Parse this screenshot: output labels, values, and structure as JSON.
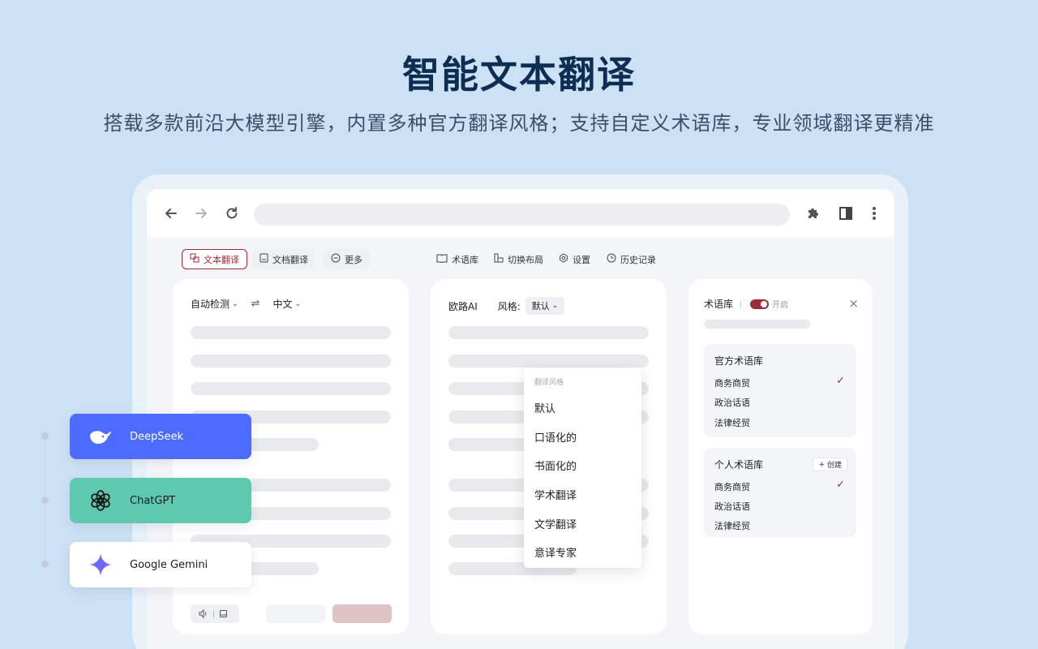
{
  "hero": {
    "title": "智能文本翻译",
    "subtitle": "搭载多款前沿大模型引擎，内置多种官方翻译风格；支持自定义术语库，专业领域翻译更精准"
  },
  "browser": {
    "icons": [
      "back-arrow-icon",
      "forward-arrow-icon",
      "reload-icon",
      "puzzle-icon",
      "side-panel-icon",
      "kebab-menu-icon"
    ]
  },
  "topbar": {
    "tabs": [
      {
        "label": "文本翻译",
        "icon": "text-translate-icon",
        "active": true
      },
      {
        "label": "文档翻译",
        "icon": "document-icon",
        "active": false
      },
      {
        "label": "更多",
        "icon": "more-circle-icon",
        "active": false
      }
    ],
    "tools": [
      {
        "label": "术语库",
        "icon": "book-icon"
      },
      {
        "label": "切换布局",
        "icon": "layout-icon"
      },
      {
        "label": "设置",
        "icon": "settings-icon"
      },
      {
        "label": "历史记录",
        "icon": "clock-icon"
      }
    ]
  },
  "source_panel": {
    "source_lang": "自动检测",
    "swap_icon": "swap-icon",
    "target_lang": "中文",
    "footer_icons": [
      "speaker-icon",
      "copy-icon"
    ]
  },
  "result_panel": {
    "engine": "欧路AI",
    "style_label": "风格:",
    "style_value": "默认"
  },
  "style_dropdown": {
    "header": "翻译风格",
    "options": [
      "默认",
      "口语化的",
      "书面化的",
      "学术翻译",
      "文学翻译",
      "意译专家"
    ]
  },
  "term_panel": {
    "title": "术语库",
    "toggle_label": "开启",
    "toggle_on": true,
    "official": {
      "title": "官方术语库",
      "items": [
        {
          "label": "商务商贸",
          "checked": true
        },
        {
          "label": "政治话语",
          "checked": false
        },
        {
          "label": "法律经贸",
          "checked": false
        }
      ]
    },
    "personal": {
      "title": "个人术语库",
      "create_label": "创建",
      "items": [
        {
          "label": "商务商贸",
          "checked": true
        },
        {
          "label": "政治话语",
          "checked": false
        },
        {
          "label": "法律经贸",
          "checked": false
        }
      ]
    }
  },
  "models": [
    {
      "name": "DeepSeek",
      "icon": "deepseek-whale-icon",
      "bg": "#4d6bfe",
      "fg": "#ffffff"
    },
    {
      "name": "ChatGPT",
      "icon": "openai-icon",
      "bg": "#5ec9ae",
      "fg": "#1b1b1b"
    },
    {
      "name": "Google Gemini",
      "icon": "gemini-star-icon",
      "bg": "#ffffff",
      "fg": "#1b1b1b"
    }
  ],
  "colors": {
    "accent": "#9b2c38",
    "page_bg": "#cde1f4",
    "title": "#0e2d52"
  }
}
